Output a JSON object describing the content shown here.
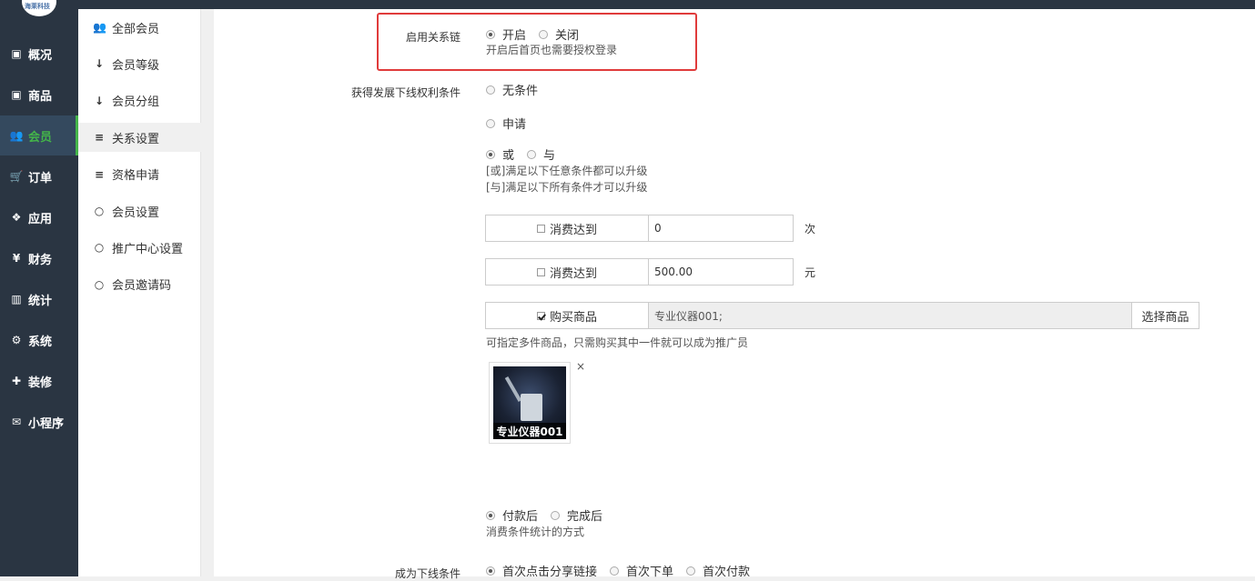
{
  "logo": {
    "text": "海莱科技"
  },
  "main_nav": [
    {
      "label": "概况",
      "icon": "dashboard-icon",
      "glyph": "▣"
    },
    {
      "label": "商品",
      "icon": "goods-icon",
      "glyph": "▣"
    },
    {
      "label": "会员",
      "icon": "users-icon",
      "glyph": "👥",
      "active": true
    },
    {
      "label": "订单",
      "icon": "cart-icon",
      "glyph": "🛒"
    },
    {
      "label": "应用",
      "icon": "apps-icon",
      "glyph": "❖"
    },
    {
      "label": "财务",
      "icon": "yen-icon",
      "glyph": "¥"
    },
    {
      "label": "统计",
      "icon": "chart-icon",
      "glyph": "▥"
    },
    {
      "label": "系统",
      "icon": "gears-icon",
      "glyph": "⚙"
    },
    {
      "label": "装修",
      "icon": "gavel-icon",
      "glyph": "✚"
    },
    {
      "label": "小程序",
      "icon": "wechat-icon",
      "glyph": "✉"
    }
  ],
  "sub_nav": [
    {
      "label": "全部会员",
      "icon": "users-icon",
      "glyph": "👥"
    },
    {
      "label": "会员等级",
      "icon": "sort-icon",
      "glyph": "↓"
    },
    {
      "label": "会员分组",
      "icon": "sort-alpha-icon",
      "glyph": "↓"
    },
    {
      "label": "关系设置",
      "icon": "sliders-icon",
      "glyph": "≡",
      "active": true
    },
    {
      "label": "资格申请",
      "icon": "sliders-icon",
      "glyph": "≡"
    },
    {
      "label": "会员设置",
      "icon": "circle-icon",
      "glyph": "○"
    },
    {
      "label": "推广中心设置",
      "icon": "circle-icon",
      "glyph": "○"
    },
    {
      "label": "会员邀请码",
      "icon": "circle-icon",
      "glyph": "○"
    }
  ],
  "form": {
    "relation_chain": {
      "label": "启用关系链",
      "options": [
        "开启",
        "关闭"
      ],
      "selected": "开启",
      "hint": "开启后首页也需要授权登录"
    },
    "develop_condition": {
      "label": "获得发展下线权利条件",
      "option_none": "无条件",
      "option_apply": "申请",
      "logic_options": [
        "或",
        "与"
      ],
      "logic_selected": "或",
      "hint_or": "[或]满足以下任意条件都可以升级",
      "hint_and": "[与]满足以下所有条件才可以升级"
    },
    "conditions": [
      {
        "label": "消费达到",
        "checked": false,
        "value": "0",
        "unit": "次"
      },
      {
        "label": "消费达到",
        "checked": false,
        "value": "500.00",
        "unit": "元"
      }
    ],
    "goods_condition": {
      "label": "购买商品",
      "checked": true,
      "value": "专业仪器001;",
      "button": "选择商品",
      "hint": "可指定多件商品，只需购买其中一件就可以成为推广员",
      "item_caption": "专业仪器001",
      "remove": "×"
    },
    "consume_timing": {
      "options": [
        "付款后",
        "完成后"
      ],
      "selected": "付款后",
      "hint": "消费条件统计的方式"
    },
    "downline_condition": {
      "label": "成为下线条件",
      "options": [
        "首次点击分享链接",
        "首次下单",
        "首次付款"
      ],
      "selected": "首次点击分享链接"
    }
  },
  "colors": {
    "sidebar": "#2a3542",
    "accent": "#44b549",
    "highlight_box": "#e03b3b"
  }
}
